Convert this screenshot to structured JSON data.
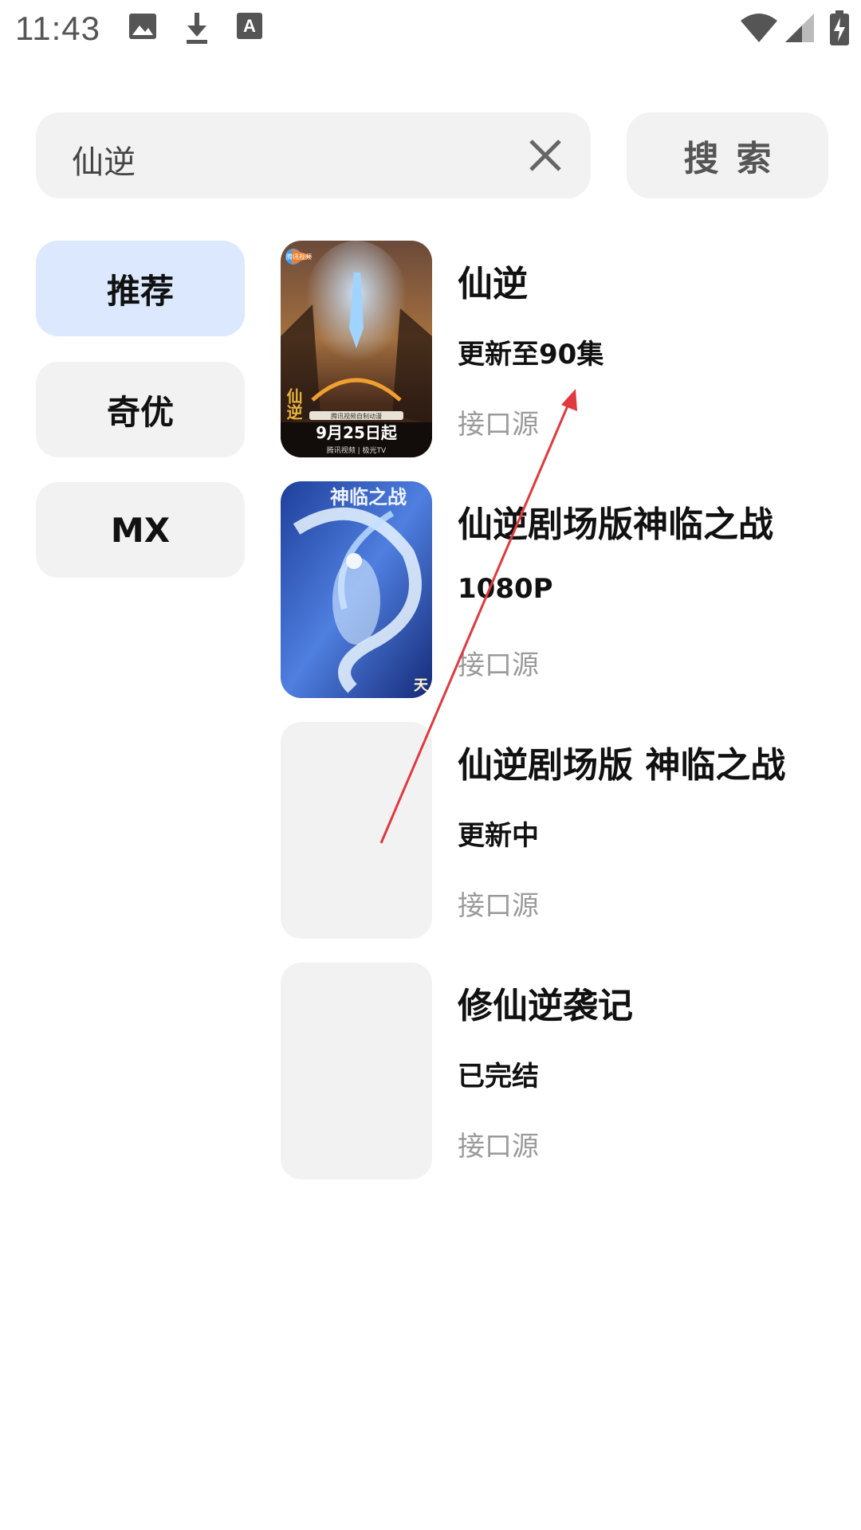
{
  "status_bar": {
    "time": "11:43",
    "left_icons": [
      "image-icon",
      "download-icon",
      "text-a-icon"
    ],
    "right_icons": [
      "wifi-icon",
      "signal-icon",
      "battery-charging-icon"
    ]
  },
  "search": {
    "query": "仙逆",
    "clear_icon": "close-icon",
    "button_label": "搜索"
  },
  "sidebar": {
    "items": [
      {
        "label": "推荐",
        "active": true
      },
      {
        "label": "奇优",
        "active": false
      },
      {
        "label": "MX",
        "active": false
      }
    ]
  },
  "results": [
    {
      "title": "仙逆",
      "subtitle": "更新至90集",
      "source": "接口源",
      "poster_text": {
        "badge": "腾讯视频",
        "line1": "腾讯视频自制动漫",
        "date": "9月25日起",
        "footer": "腾讯视频 | 极光TV",
        "side": "仙逆"
      }
    },
    {
      "title": "仙逆剧场版神临之战",
      "subtitle": "1080P",
      "source": "接口源",
      "poster_text": {
        "title": "神临之战",
        "corner": "天"
      }
    },
    {
      "title": "仙逆剧场版 神临之战",
      "subtitle": "更新中",
      "source": "接口源",
      "poster_text": null
    },
    {
      "title": "修仙逆袭记",
      "subtitle": "已完结",
      "source": "接口源",
      "poster_text": null
    }
  ],
  "colors": {
    "background": "#ffffff",
    "field": "#f2f2f2",
    "active_tab": "#dce8fd",
    "muted_text": "#9a9a9a",
    "annotation_arrow": "#e0393e"
  }
}
